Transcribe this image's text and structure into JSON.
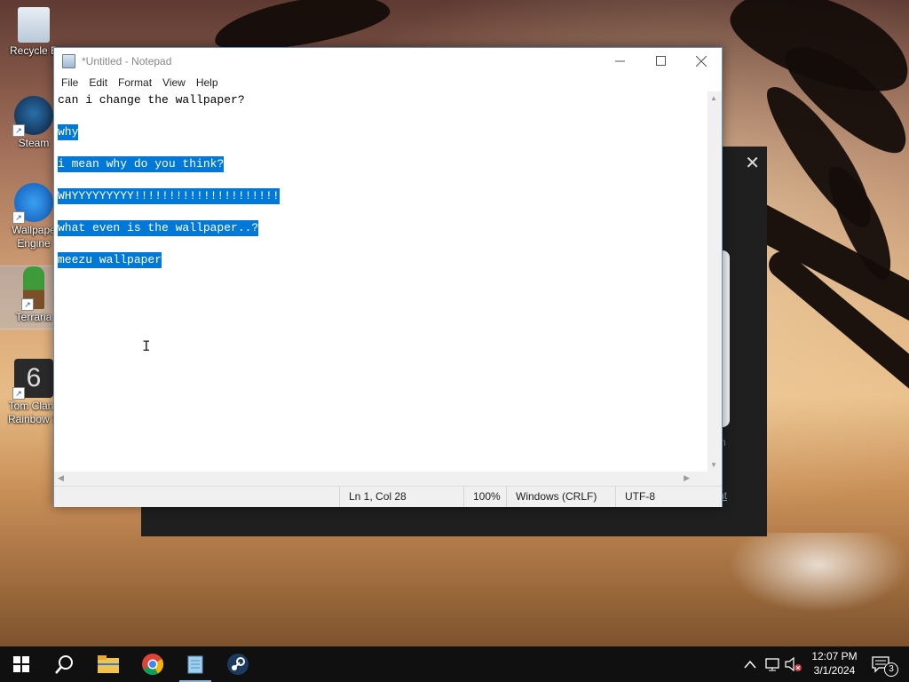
{
  "desktop": {
    "icons": [
      {
        "label": "Recycle B"
      },
      {
        "label": "Steam"
      },
      {
        "label": "Wallpaper Engine",
        "line1": "Wallpape",
        "line2": "Engine"
      },
      {
        "label": "Terraria"
      },
      {
        "label": "Tom Clanc Rainbow S",
        "line1": "Tom Clanc",
        "line2": "Rainbow S"
      }
    ]
  },
  "background_dialog": {
    "close_glyph": "✕",
    "fragment_1": "n",
    "fragment_2": "nt"
  },
  "notepad": {
    "title": "*Untitled - Notepad",
    "menu": [
      "File",
      "Edit",
      "Format",
      "View",
      "Help"
    ],
    "lines": [
      {
        "text": "can i change the wallpaper?",
        "selected": false
      },
      {
        "text": "why",
        "selected": true
      },
      {
        "text": "i mean why do you think?",
        "selected": true
      },
      {
        "text": "WHYYYYYYYYY!!!!!!!!!!!!!!!!!!!!!",
        "selected": true
      },
      {
        "text": "what even is the wallpaper..?",
        "selected": true
      },
      {
        "text": "meezu wallpaper",
        "selected": true
      }
    ],
    "status": {
      "position": "Ln 1, Col 28",
      "zoom": "100%",
      "line_ending": "Windows (CRLF)",
      "encoding": "UTF-8"
    }
  },
  "taskbar": {
    "apps": [
      "start-icon",
      "search-icon",
      "file-explorer-icon",
      "chrome-icon",
      "notepad-icon",
      "steam-icon"
    ],
    "clock": {
      "time": "12:07 PM",
      "date": "3/1/2024"
    },
    "notification_count": "3"
  }
}
